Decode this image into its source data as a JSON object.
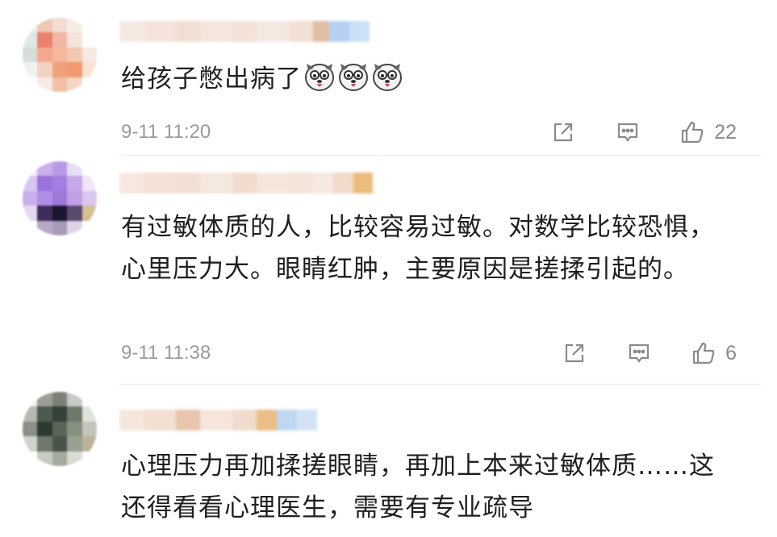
{
  "comments": [
    {
      "text": "给孩子憋出病了",
      "emoji": [
        "dog-face-emoji",
        "dog-face-emoji",
        "dog-face-emoji"
      ],
      "time": "9-11 11:20",
      "likes": "22"
    },
    {
      "text": "有过敏体质的人，比较容易过敏。对数学比较恐惧，心里压力大。眼睛红肿，主要原因是搓揉引起的。",
      "time": "9-11 11:38",
      "likes": "6"
    },
    {
      "text": "心理压力再加揉搓眼睛，再加上本来过敏体质……这还得看看心理医生，需要有专业疏导"
    }
  ],
  "icons": {
    "share": "share-icon",
    "reply": "comment-icon",
    "like": "thumbs-up-icon"
  },
  "colors": {
    "text": "#1f1f1f",
    "meta": "#9a9a9a",
    "icon": "#8a8a8a"
  }
}
